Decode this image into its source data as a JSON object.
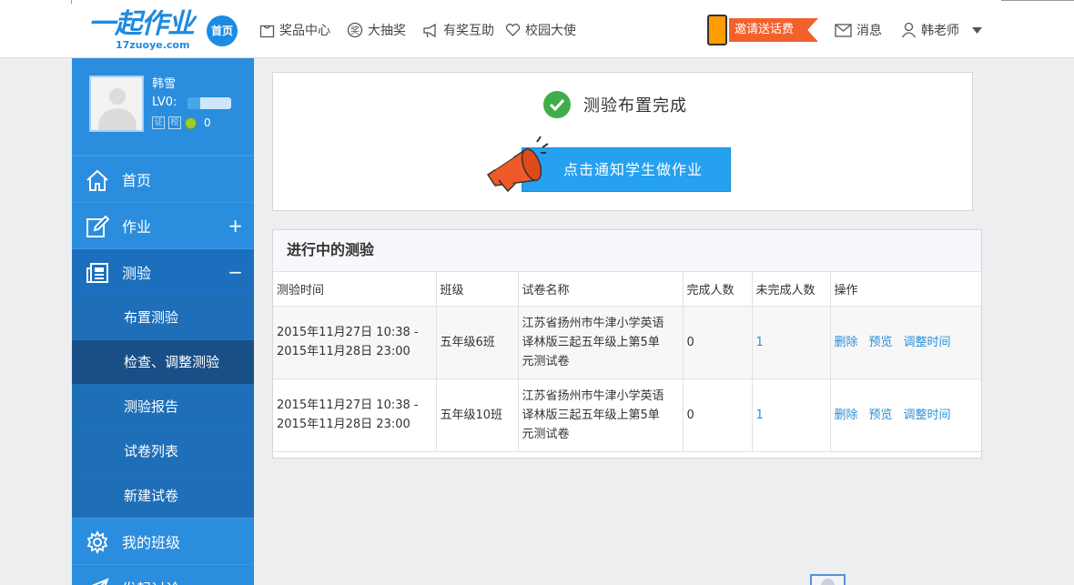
{
  "header": {
    "logo_text": "一起作业",
    "logo_sub": "17zuoye.com",
    "home_badge": "首页",
    "nav": [
      {
        "label": "奖品中心",
        "icon": "gift-icon"
      },
      {
        "label": "大抽奖",
        "icon": "lottery-icon"
      },
      {
        "label": "有奖互助",
        "icon": "megaphone-icon"
      },
      {
        "label": "校园大使",
        "icon": "heart-icon"
      }
    ],
    "invite_label": "邀请送话费",
    "messages_label": "消息",
    "user_label": "韩老师"
  },
  "profile": {
    "name": "韩雪",
    "level": "LV0:",
    "level_progress": 0.3,
    "bean_count": "0",
    "badge_1": "证",
    "badge_2": "校"
  },
  "sidebar": {
    "items": [
      {
        "label": "首页",
        "icon": "home-icon"
      },
      {
        "label": "作业",
        "icon": "edit-icon",
        "sign": "+"
      },
      {
        "label": "测验",
        "icon": "newspaper-icon",
        "sign": "−"
      }
    ],
    "sub_items": [
      "布置测验",
      "检查、调整测验",
      "测验报告",
      "试卷列表",
      "新建试卷"
    ],
    "more_items": [
      {
        "label": "我的班级",
        "icon": "gear-icon"
      },
      {
        "label": "发起讨论",
        "icon": "paper-plane-icon"
      }
    ]
  },
  "notice": {
    "title": "测验布置完成",
    "button_label": "点击通知学生做作业"
  },
  "tests": {
    "title": "进行中的测验",
    "columns": [
      "测验时间",
      "班级",
      "试卷名称",
      "完成人数",
      "未完成人数",
      "操作"
    ],
    "rows": [
      {
        "time_start": "2015年11月27日 10:38 -",
        "time_end": "2015年11月28日 23:00",
        "class": "五年级6班",
        "paper_l1": "江苏省扬州市牛津小学英语",
        "paper_l2": "译林版三起五年级上第5单",
        "paper_l3": "元测试卷",
        "done": "0",
        "undone": "1"
      },
      {
        "time_start": "2015年11月27日 10:38 -",
        "time_end": "2015年11月28日 23:00",
        "class": "五年级10班",
        "paper_l1": "江苏省扬州市牛津小学英语",
        "paper_l2": "译林版三起五年级上第5单",
        "paper_l3": "元测试卷",
        "done": "0",
        "undone": "1"
      }
    ],
    "actions": [
      "删除",
      "预览",
      "调整时间"
    ]
  },
  "colors": {
    "brand_blue": "#1d8be0",
    "sidebar_blue": "#2a8ddd",
    "sidebar_selected": "#184f86",
    "button_blue": "#26a1f0",
    "success_green": "#3fae49",
    "invite_orange": "#f2612c"
  }
}
